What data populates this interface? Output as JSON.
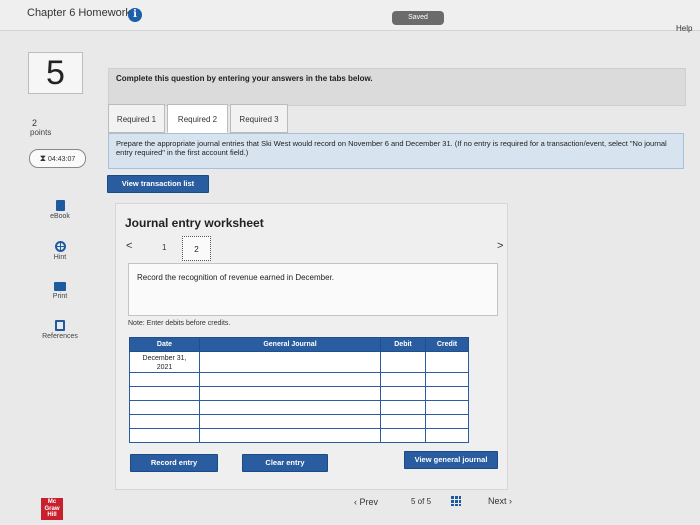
{
  "header": {
    "title": "Chapter 6 Homework",
    "info_glyph": "i",
    "saved_label": "Saved",
    "help_label": "Help"
  },
  "question": {
    "number": "5",
    "points_value": "2",
    "points_label": "points",
    "timer": "04:43:07"
  },
  "side_tools": [
    {
      "label": "eBook",
      "icon": "ebook-icon"
    },
    {
      "label": "Hint",
      "icon": "hint-icon"
    },
    {
      "label": "Print",
      "icon": "print-icon"
    },
    {
      "label": "References",
      "icon": "references-icon"
    }
  ],
  "instruction": "Complete this question by entering your answers in the tabs below.",
  "tabs": [
    {
      "label": "Required 1",
      "active": false
    },
    {
      "label": "Required 2",
      "active": true
    },
    {
      "label": "Required 3",
      "active": false
    }
  ],
  "prompt": "Prepare the appropriate journal entries that Ski West would record on November 6 and December 31. (If no entry is required for a transaction/event, select \"No journal entry required\" in the first account field.)",
  "view_transaction_label": "View transaction list",
  "worksheet": {
    "title": "Journal entry worksheet",
    "pager_prev": "<",
    "pager_next": ">",
    "pages": [
      "1",
      "2"
    ],
    "record_text": "Record the recognition of revenue earned in December.",
    "note": "Note: Enter debits before credits.",
    "table": {
      "headers": {
        "date": "Date",
        "account": "General Journal",
        "debit": "Debit",
        "credit": "Credit"
      },
      "first_date_line1": "December 31,",
      "first_date_line2": "2021"
    },
    "record_entry_label": "Record entry",
    "clear_entry_label": "Clear entry",
    "view_general_journal_label": "View general journal"
  },
  "footer": {
    "logo_line1": "Mc",
    "logo_line2": "Graw",
    "logo_line3": "Hill",
    "prev_label": "Prev",
    "page_count": "5 of 5",
    "next_label": "Next"
  },
  "colors": {
    "accent": "#2a5da0",
    "prompt_bg": "#d7e3ef",
    "logo_red": "#c8202f"
  }
}
